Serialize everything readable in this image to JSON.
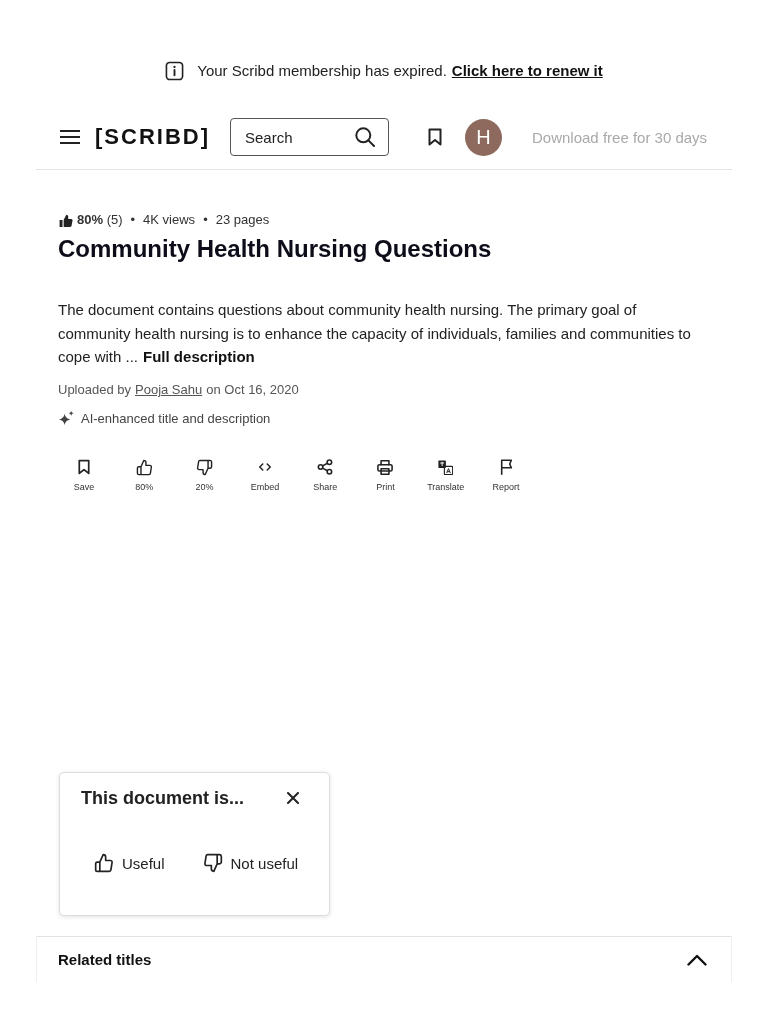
{
  "banner": {
    "message": "Your Scribd membership has expired.",
    "link": "Click here to renew it"
  },
  "header": {
    "logo": "[SCRIBD]",
    "search": {
      "placeholder": "Search"
    },
    "avatar": "H",
    "download": "Download free for 30 days"
  },
  "document": {
    "rating": "**80%** (5)",
    "stats": [
      {
        "separator": "•",
        "text": "4K views"
      },
      {
        "separator": "•",
        "text": "23 pages"
      }
    ],
    "title": "Community Health Nursing Questions",
    "description": "The document contains questions about community health nursing. The primary goal of community health nursing is to enhance the capacity of individuals, families and communities to cope with ...",
    "more_link": "Full description",
    "upload": {
      "prefix": "Uploaded by",
      "author": "Pooja Sahu",
      "suffix": "on Oct 16, 2020"
    },
    "ai_note": "AI-enhanced title and description"
  },
  "actions": [
    {
      "kind": "save",
      "label": "Save"
    },
    {
      "kind": "like",
      "label": "80%"
    },
    {
      "kind": "dislike",
      "label": "20%"
    },
    {
      "kind": "embed",
      "label": "Embed"
    },
    {
      "kind": "share",
      "label": "Share"
    },
    {
      "kind": "print",
      "label": "Print"
    },
    {
      "kind": "translate",
      "label": "Translate"
    },
    {
      "kind": "report",
      "label": "Report"
    }
  ],
  "feedback_popup": {
    "title": "This document is...",
    "options": [
      {
        "kind": "useful",
        "label": "Useful"
      },
      {
        "kind": "not_useful",
        "label": "Not useful"
      }
    ]
  },
  "related": {
    "title": "Related titles"
  }
}
